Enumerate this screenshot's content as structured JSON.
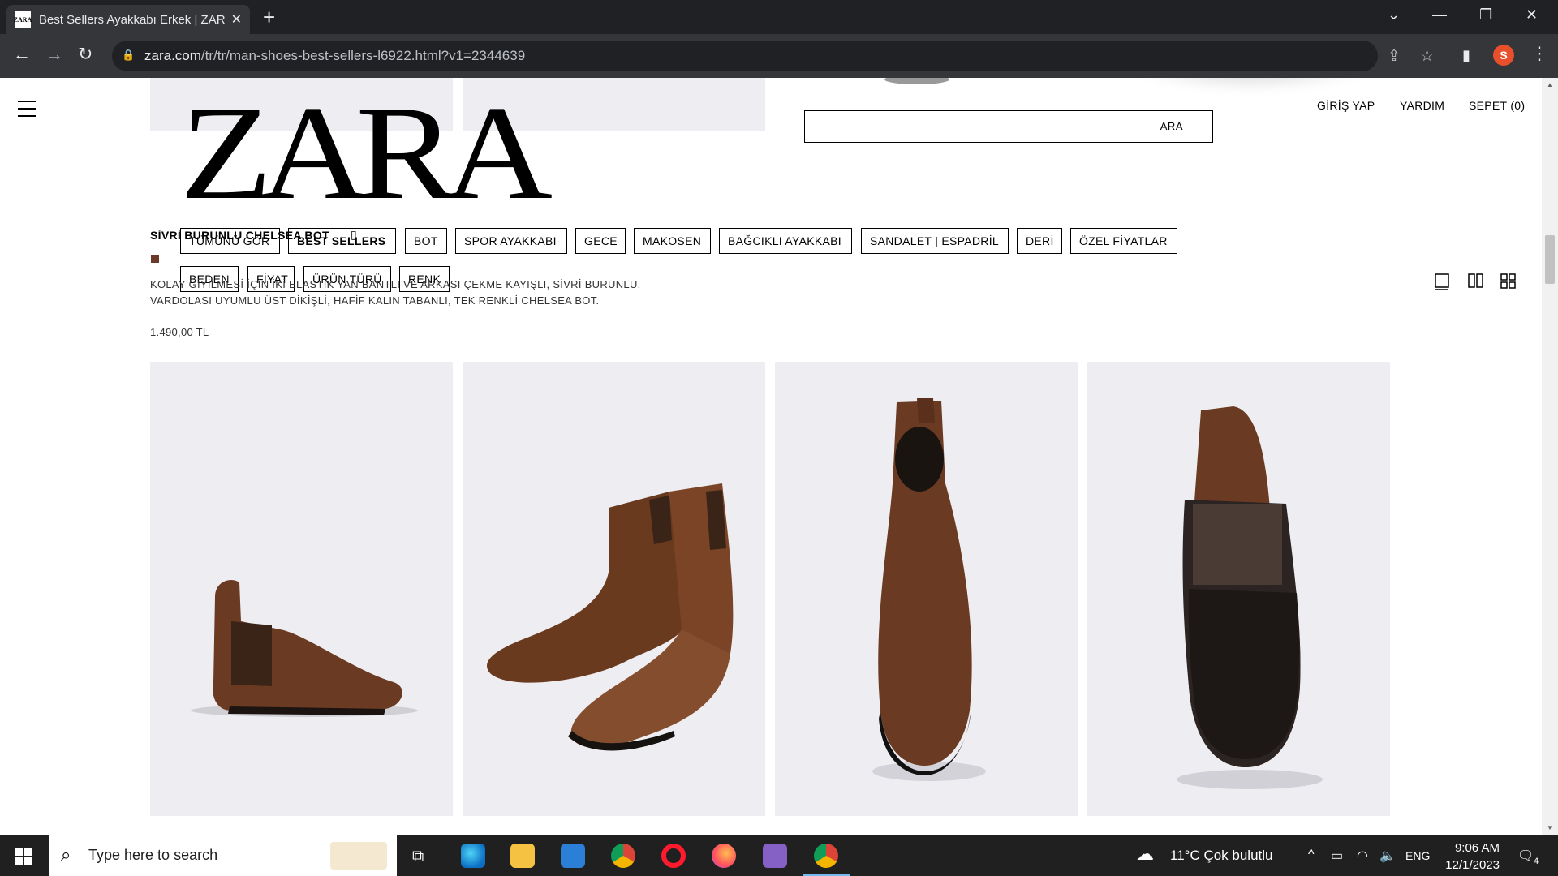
{
  "browser": {
    "tab_title": "Best Sellers Ayakkabı Erkek | ZAR",
    "tab_favicon_text": "ZARA",
    "url_domain": "zara.com",
    "url_path": "/tr/tr/man-shoes-best-sellers-l6922.html?v1=2344639",
    "profile_initial": "S"
  },
  "header": {
    "logo": "ZARA",
    "search_label": "ARA",
    "login": "GİRİŞ YAP",
    "help": "YARDIM",
    "cart": "SEPET (0)"
  },
  "filters": {
    "categories": [
      "TÜMÜNÜ GÖR",
      "BEST SELLERS",
      "BOT",
      "SPOR AYAKKABI",
      "GECE",
      "MAKOSEN",
      "BAĞCIKLI AYAKKABI",
      "SANDALET | ESPADRİL",
      "DERİ",
      "ÖZEL FİYATLAR"
    ],
    "facets": [
      "BEDEN",
      "FİYAT",
      "ÜRÜN TÜRÜ",
      "RENK"
    ]
  },
  "product": {
    "name": "SİVRİ BURUNLU CHELSEA BOT",
    "description_line1": "KOLAY GİYİLMESİ İÇİN İKİ ELASTİK YAN BANTLI VE ARKASI ÇEKME KAYIŞLI, SİVRİ BURUNLU,",
    "description_line2": "VARDOLASI UYUMLU ÜST DİKİŞLİ, HAFİF KALIN TABANLI, TEK RENKLİ CHELSEA BOT.",
    "price": "1.490,00 TL",
    "swatch_color": "#6b3a2a"
  },
  "taskbar": {
    "search_placeholder": "Type here to search",
    "weather": "11°C  Çok bulutlu",
    "language": "ENG",
    "time": "9:06 AM",
    "date": "12/1/2023",
    "notification_count": "4"
  }
}
